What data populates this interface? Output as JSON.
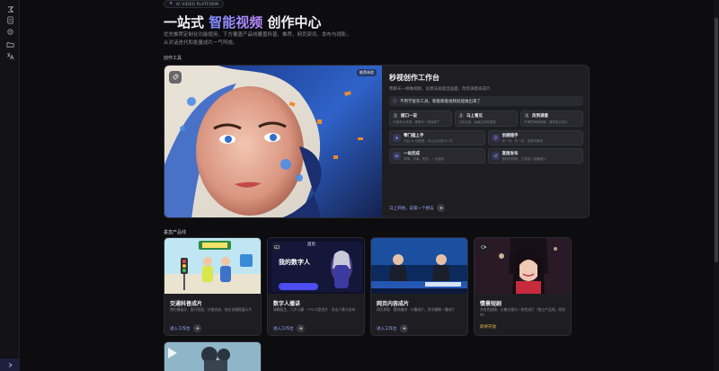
{
  "sidebar": {
    "icons": [
      "logo-icon",
      "document-icon",
      "gear-icon",
      "folder-icon",
      "translate-icon"
    ],
    "expand_icon": "chevron-right-icon"
  },
  "hero": {
    "badge": "AI VIDEO PLATFORM",
    "title_prefix": "一站式",
    "title_highlight": "智能视频",
    "title_suffix": "创作中心",
    "description": "优先推荐定制化功能使用，下方覆盖产品线覆盖科普、推荐、网页资讯、发布与视影，从对话迭代和批量成片一气呵成。"
  },
  "sections": {
    "tools_label": "创作工具",
    "products_label": "垂直产品线"
  },
  "feature": {
    "tag": "推荐体验",
    "title": "秒视创作工作台",
    "subtitle": "像聊天一样做视频，设想法就能出画面，改到满意再成片",
    "note": "不用学复杂工具，聊着聊着视频就能做出来了",
    "steps": [
      {
        "num": "1",
        "title": "随口一说",
        "desc": "不懂专业术语，像聊天一样就够了"
      },
      {
        "num": "2",
        "title": "马上看见",
        "desc": "几秒出结，画面立即在眼前"
      },
      {
        "num": "3",
        "title": "改到满意",
        "desc": "不满意就继续聊，满意就去成片"
      }
    ],
    "features": [
      {
        "title": "零门槛上手",
        "desc": "不会 AI 也能做，可以让你多问一次",
        "icon": "sparkle-icon"
      },
      {
        "title": "创想随手",
        "desc": "改一句，改一张，灵感不断线",
        "icon": "lightbulb-icon"
      },
      {
        "title": "一站完成",
        "desc": "剪辑、字幕、配乐，一站搞定",
        "icon": "layers-icon"
      },
      {
        "title": "直接发布",
        "desc": "做好的视频，立即投入直播成片",
        "icon": "send-icon"
      }
    ],
    "cta": "马上开始，说第一个想法"
  },
  "cards": [
    {
      "title": "交通科普成片",
      "desc": "预约模板好，客开画面，分镜合成，商业化播报展示片",
      "link": "进入工作台",
      "gold": false,
      "icon": ""
    },
    {
      "title": "数字人播讲",
      "desc": "请模板生，六步计算 · TTS 口型成片 · 导出人像与发布",
      "link": "进入工作台",
      "gold": false,
      "icon": "image-icon",
      "thumb_label": "首页",
      "thumb_heading": "我的数字人"
    },
    {
      "title": "网页内容成片",
      "desc": "网页抓取 · 素材编排 · 口播成片，资讯播播一播成片",
      "link": "进入工作台",
      "gold": false,
      "icon": ""
    },
    {
      "title": "情景短剧",
      "desc": "关各色剧情，分集分镜与一致性成片（独立产品线，研发中）",
      "link": "即将开放",
      "gold": true,
      "icon": "video-icon"
    }
  ],
  "colors": {
    "background": "#0d0d10",
    "card": "#1e1e22",
    "accent": "#9aa8ff",
    "gold": "#e8b64a"
  }
}
